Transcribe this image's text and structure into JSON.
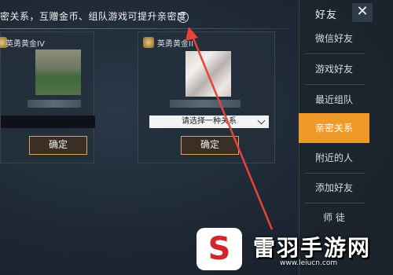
{
  "header": {
    "text": "密关系，互赠金币、组队游戏可提升亲密度",
    "help_icon": "help-circle-icon"
  },
  "cards": [
    {
      "rank_label": "英勇黄金IV",
      "select_placeholder": "",
      "confirm_label": "确定"
    },
    {
      "rank_label": "英勇黄金II",
      "select_placeholder": "请选择一种关系",
      "confirm_label": "确定"
    }
  ],
  "sidebar": {
    "title": "好友",
    "close_icon": "close-icon",
    "items": [
      {
        "label": "微信好友",
        "active": false
      },
      {
        "label": "游戏好友",
        "active": false
      },
      {
        "label": "最近组队",
        "active": false
      },
      {
        "label": "亲密关系",
        "active": true
      },
      {
        "label": "附近的人",
        "active": false
      },
      {
        "label": "添加好友",
        "active": false
      },
      {
        "label": "师 徒",
        "active": false
      }
    ]
  },
  "annotation": {
    "arrow_color": "#e8423a"
  },
  "colors": {
    "accent": "#f0992b",
    "button_border": "#d9a35a"
  },
  "watermark": {
    "title": "雷羽手游网",
    "url": "www.leiucn.com"
  }
}
